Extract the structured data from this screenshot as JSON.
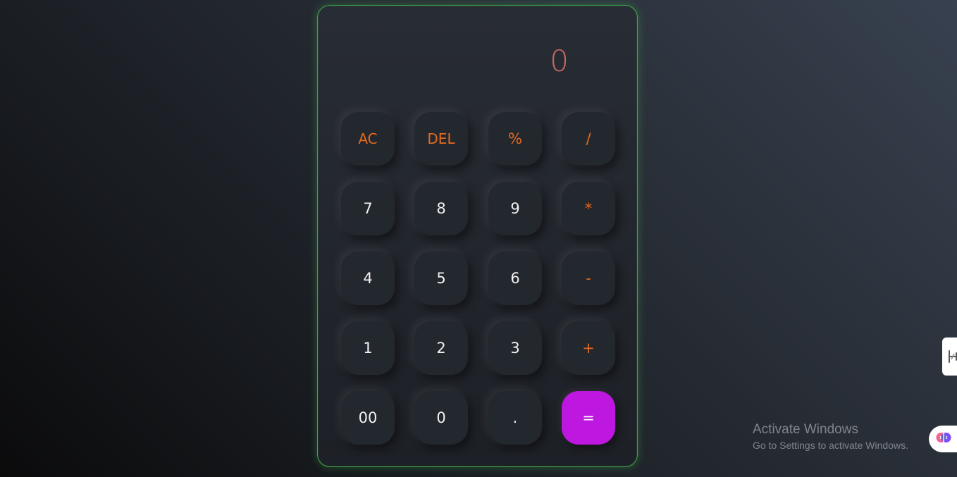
{
  "calculator": {
    "display": "0",
    "keys": [
      {
        "label": "AC",
        "type": "fn",
        "name": "ac-button"
      },
      {
        "label": "DEL",
        "type": "fn",
        "name": "delete-button"
      },
      {
        "label": "%",
        "type": "op",
        "name": "percent-button"
      },
      {
        "label": "/",
        "type": "op",
        "name": "divide-button"
      },
      {
        "label": "7",
        "type": "num",
        "name": "digit-7-button"
      },
      {
        "label": "8",
        "type": "num",
        "name": "digit-8-button"
      },
      {
        "label": "9",
        "type": "num",
        "name": "digit-9-button"
      },
      {
        "label": "*",
        "type": "op",
        "name": "multiply-button"
      },
      {
        "label": "4",
        "type": "num",
        "name": "digit-4-button"
      },
      {
        "label": "5",
        "type": "num",
        "name": "digit-5-button"
      },
      {
        "label": "6",
        "type": "num",
        "name": "digit-6-button"
      },
      {
        "label": "-",
        "type": "op",
        "name": "subtract-button"
      },
      {
        "label": "1",
        "type": "num",
        "name": "digit-1-button"
      },
      {
        "label": "2",
        "type": "num",
        "name": "digit-2-button"
      },
      {
        "label": "3",
        "type": "num",
        "name": "digit-3-button"
      },
      {
        "label": "+",
        "type": "op",
        "name": "add-button"
      },
      {
        "label": "00",
        "type": "num",
        "name": "double-zero-button"
      },
      {
        "label": "0",
        "type": "num",
        "name": "digit-0-button"
      },
      {
        "label": ".",
        "type": "num",
        "name": "decimal-button"
      },
      {
        "label": "=",
        "type": "equals",
        "name": "equals-button"
      }
    ]
  },
  "watermark": {
    "title": "Activate Windows",
    "subtitle": "Go to Settings to activate Windows."
  },
  "overlay": {
    "side_tab_icon": "resize-icon",
    "extension_icon": "brain-icon"
  },
  "colors": {
    "operator": "#e56b1f",
    "equals_bg": "#be17e0",
    "display_text": "#c96a62",
    "border_glow": "#3fa24a"
  }
}
